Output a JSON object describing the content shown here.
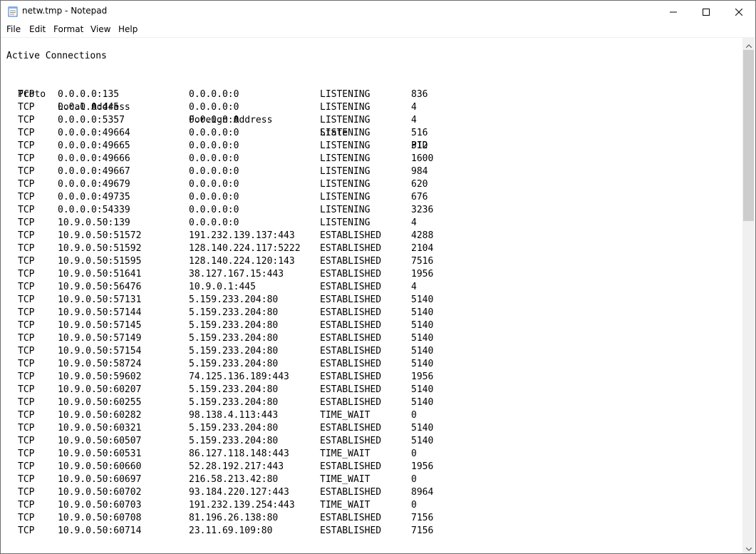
{
  "window": {
    "title": "netw.tmp - Notepad"
  },
  "menu": [
    "File",
    "Edit",
    "Format",
    "View",
    "Help"
  ],
  "document": {
    "heading": "Active Connections",
    "columns": [
      "Proto",
      "Local Address",
      "Foreign Address",
      "State",
      "PID"
    ],
    "rows": [
      [
        "TCP",
        "0.0.0.0:135",
        "0.0.0.0:0",
        "LISTENING",
        "836"
      ],
      [
        "TCP",
        "0.0.0.0:445",
        "0.0.0.0:0",
        "LISTENING",
        "4"
      ],
      [
        "TCP",
        "0.0.0.0:5357",
        "0.0.0.0:0",
        "LISTENING",
        "4"
      ],
      [
        "TCP",
        "0.0.0.0:49664",
        "0.0.0.0:0",
        "LISTENING",
        "516"
      ],
      [
        "TCP",
        "0.0.0.0:49665",
        "0.0.0.0:0",
        "LISTENING",
        "312"
      ],
      [
        "TCP",
        "0.0.0.0:49666",
        "0.0.0.0:0",
        "LISTENING",
        "1600"
      ],
      [
        "TCP",
        "0.0.0.0:49667",
        "0.0.0.0:0",
        "LISTENING",
        "984"
      ],
      [
        "TCP",
        "0.0.0.0:49679",
        "0.0.0.0:0",
        "LISTENING",
        "620"
      ],
      [
        "TCP",
        "0.0.0.0:49735",
        "0.0.0.0:0",
        "LISTENING",
        "676"
      ],
      [
        "TCP",
        "0.0.0.0:54339",
        "0.0.0.0:0",
        "LISTENING",
        "3236"
      ],
      [
        "TCP",
        "10.9.0.50:139",
        "0.0.0.0:0",
        "LISTENING",
        "4"
      ],
      [
        "TCP",
        "10.9.0.50:51572",
        "191.232.139.137:443",
        "ESTABLISHED",
        "4288"
      ],
      [
        "TCP",
        "10.9.0.50:51592",
        "128.140.224.117:5222",
        "ESTABLISHED",
        "2104"
      ],
      [
        "TCP",
        "10.9.0.50:51595",
        "128.140.224.120:143",
        "ESTABLISHED",
        "7516"
      ],
      [
        "TCP",
        "10.9.0.50:51641",
        "38.127.167.15:443",
        "ESTABLISHED",
        "1956"
      ],
      [
        "TCP",
        "10.9.0.50:56476",
        "10.9.0.1:445",
        "ESTABLISHED",
        "4"
      ],
      [
        "TCP",
        "10.9.0.50:57131",
        "5.159.233.204:80",
        "ESTABLISHED",
        "5140"
      ],
      [
        "TCP",
        "10.9.0.50:57144",
        "5.159.233.204:80",
        "ESTABLISHED",
        "5140"
      ],
      [
        "TCP",
        "10.9.0.50:57145",
        "5.159.233.204:80",
        "ESTABLISHED",
        "5140"
      ],
      [
        "TCP",
        "10.9.0.50:57149",
        "5.159.233.204:80",
        "ESTABLISHED",
        "5140"
      ],
      [
        "TCP",
        "10.9.0.50:57154",
        "5.159.233.204:80",
        "ESTABLISHED",
        "5140"
      ],
      [
        "TCP",
        "10.9.0.50:58724",
        "5.159.233.204:80",
        "ESTABLISHED",
        "5140"
      ],
      [
        "TCP",
        "10.9.0.50:59602",
        "74.125.136.189:443",
        "ESTABLISHED",
        "1956"
      ],
      [
        "TCP",
        "10.9.0.50:60207",
        "5.159.233.204:80",
        "ESTABLISHED",
        "5140"
      ],
      [
        "TCP",
        "10.9.0.50:60255",
        "5.159.233.204:80",
        "ESTABLISHED",
        "5140"
      ],
      [
        "TCP",
        "10.9.0.50:60282",
        "98.138.4.113:443",
        "TIME_WAIT",
        "0"
      ],
      [
        "TCP",
        "10.9.0.50:60321",
        "5.159.233.204:80",
        "ESTABLISHED",
        "5140"
      ],
      [
        "TCP",
        "10.9.0.50:60507",
        "5.159.233.204:80",
        "ESTABLISHED",
        "5140"
      ],
      [
        "TCP",
        "10.9.0.50:60531",
        "86.127.118.148:443",
        "TIME_WAIT",
        "0"
      ],
      [
        "TCP",
        "10.9.0.50:60660",
        "52.28.192.217:443",
        "ESTABLISHED",
        "1956"
      ],
      [
        "TCP",
        "10.9.0.50:60697",
        "216.58.213.42:80",
        "TIME_WAIT",
        "0"
      ],
      [
        "TCP",
        "10.9.0.50:60702",
        "93.184.220.127:443",
        "ESTABLISHED",
        "8964"
      ],
      [
        "TCP",
        "10.9.0.50:60703",
        "191.232.139.254:443",
        "TIME_WAIT",
        "0"
      ],
      [
        "TCP",
        "10.9.0.50:60708",
        "81.196.26.138:80",
        "ESTABLISHED",
        "7156"
      ],
      [
        "TCP",
        "10.9.0.50:60714",
        "23.11.69.109:80",
        "ESTABLISHED",
        "7156"
      ]
    ]
  },
  "icons": {
    "app": "notepad-icon",
    "minimize": "minimize-icon",
    "maximize": "maximize-icon",
    "close": "close-icon",
    "scroll_up": "chevron-up-icon",
    "scroll_down": "chevron-down-icon"
  }
}
